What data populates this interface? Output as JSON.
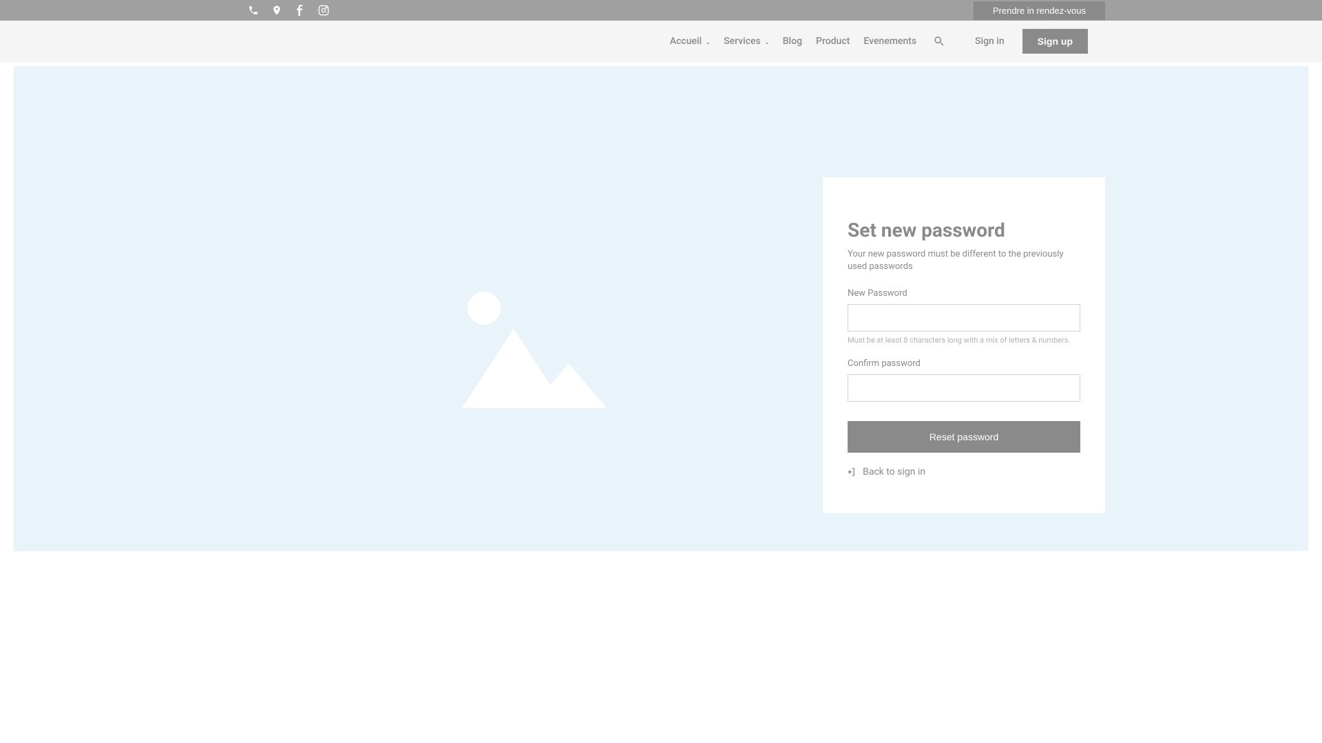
{
  "topbar": {
    "appointment_label": "Prendre in rendez-vous"
  },
  "nav": {
    "items": [
      {
        "label": "Accueil",
        "has_dropdown": true
      },
      {
        "label": "Services",
        "has_dropdown": true
      },
      {
        "label": "Blog",
        "has_dropdown": false
      },
      {
        "label": "Product",
        "has_dropdown": false
      },
      {
        "label": "Evenements",
        "has_dropdown": false
      }
    ],
    "signin_label": "Sign in",
    "signup_label": "Sign up"
  },
  "form": {
    "title": "Set new password",
    "subtitle": "Your new password must be different to the previously used passwords",
    "new_password_label": "New Password",
    "new_password_value": "",
    "password_hint": "Must be at least 8 characters long with a mix of letters & numbers.",
    "confirm_label": "Confirm password",
    "confirm_value": "",
    "reset_button_label": "Reset password",
    "back_link_label": "Back to sign in"
  },
  "icons": {
    "phone": "phone-icon",
    "location": "location-icon",
    "facebook": "facebook-icon",
    "instagram": "instagram-icon",
    "search": "search-icon",
    "chevron_down": "chevron-down-icon",
    "back_arrow": "back-arrow-icon"
  }
}
